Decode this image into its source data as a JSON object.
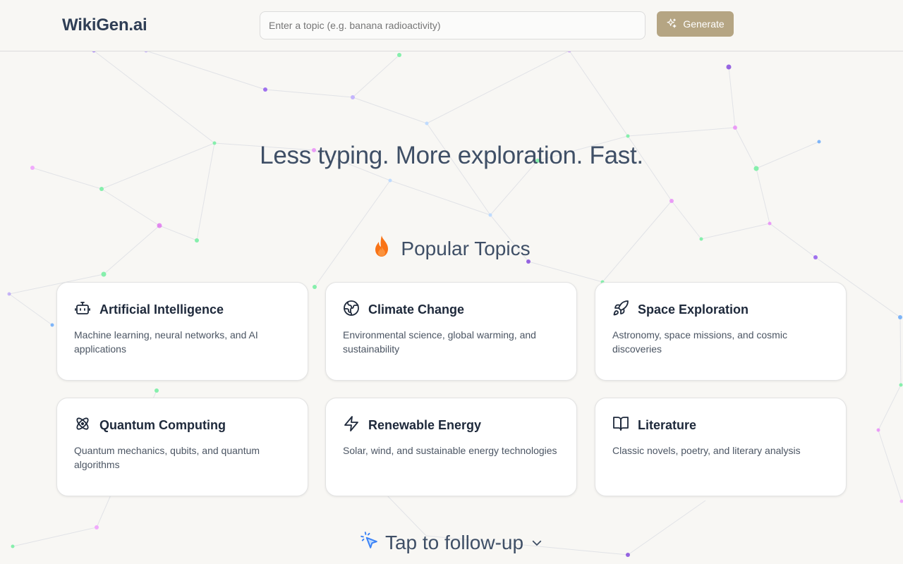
{
  "header": {
    "logo": "WikiGen.ai",
    "search_placeholder": "Enter a topic (e.g. banana radioactivity)",
    "generate_label": "Generate"
  },
  "hero": {
    "tagline": "Less typing. More exploration. Fast."
  },
  "popular": {
    "title": "Popular Topics",
    "icon": "fire-icon",
    "cards": [
      {
        "icon": "robot-icon",
        "title": "Artificial Intelligence",
        "description": "Machine learning, neural networks, and AI applications"
      },
      {
        "icon": "globe-icon",
        "title": "Climate Change",
        "description": "Environmental science, global warming, and sustainability"
      },
      {
        "icon": "rocket-icon",
        "title": "Space Exploration",
        "description": "Astronomy, space missions, and cosmic discoveries"
      },
      {
        "icon": "atom-icon",
        "title": "Quantum Computing",
        "description": "Quantum mechanics, qubits, and quantum algorithms"
      },
      {
        "icon": "lightning-icon",
        "title": "Renewable Energy",
        "description": "Solar, wind, and sustainable energy technologies"
      },
      {
        "icon": "book-icon",
        "title": "Literature",
        "description": "Classic novels, poetry, and literary analysis"
      }
    ]
  },
  "follow_up": {
    "label": "Tap to follow-up",
    "icon": "cursor-click-icon"
  },
  "colors": {
    "accent": "#b5a583",
    "heading": "#3f4f66",
    "background": "#f8f7f4",
    "fire": "#f97316",
    "cursor": "#3b82f6"
  }
}
